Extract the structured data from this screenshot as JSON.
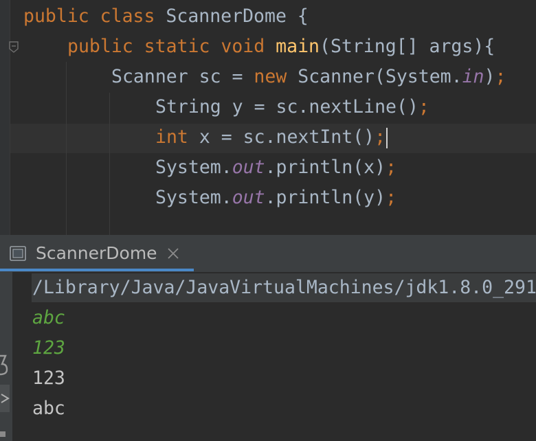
{
  "editor": {
    "line1": {
      "kw": "public class",
      "rest": " ScannerDome {"
    },
    "line2": {
      "kw": "public static void",
      "method": "main",
      "rest": "(String[] args){"
    },
    "line3": {
      "pre": "Scanner sc = ",
      "kw": "new",
      "mid": " Scanner(System.",
      "field": "in",
      "post": ")",
      "semi": ";"
    },
    "line4": {
      "text": "String y = sc.nextLine()",
      "semi": ";"
    },
    "line5": {
      "kw": "int",
      "text": " x = sc.nextInt()",
      "semi": ";"
    },
    "line6": {
      "pre": "System.",
      "field": "out",
      "post": ".println(x)",
      "semi": ";"
    },
    "line7": {
      "pre": "System.",
      "field": "out",
      "post": ".println(y)",
      "semi": ";"
    }
  },
  "run_panel": {
    "tab_label": "ScannerDome",
    "icon": "console-icon"
  },
  "console": {
    "command": "/Library/Java/JavaVirtualMachines/jdk1.8.0_291",
    "input1": "abc",
    "input2": "123",
    "output1": "123",
    "output2": "abc"
  },
  "colors": {
    "keyword": "#cc7832",
    "method": "#ffc66d",
    "field": "#9876aa",
    "text": "#a9b7c6",
    "console_input": "#5ea641",
    "tab_underline": "#4a88c7"
  }
}
